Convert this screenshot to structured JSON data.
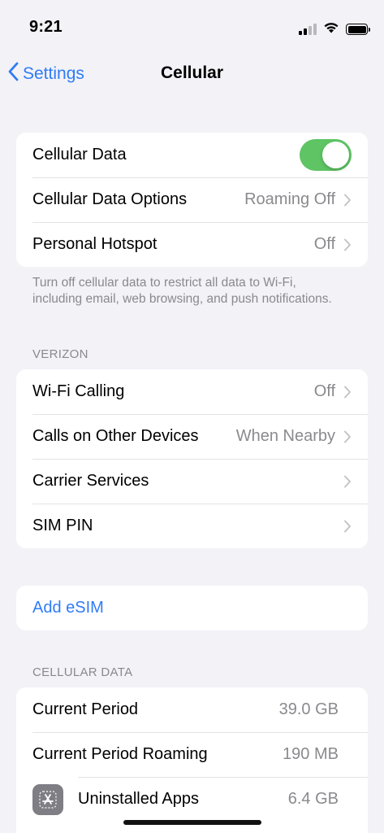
{
  "status_bar": {
    "time": "9:21"
  },
  "nav": {
    "back_label": "Settings",
    "title": "Cellular"
  },
  "group_main": {
    "cellular_data_label": "Cellular Data",
    "cellular_data_on": true,
    "cellular_data_options_label": "Cellular Data Options",
    "cellular_data_options_value": "Roaming Off",
    "personal_hotspot_label": "Personal Hotspot",
    "personal_hotspot_value": "Off"
  },
  "footnote": "Turn off cellular data to restrict all data to Wi-Fi, including email, web browsing, and push notifications.",
  "verizon": {
    "header": "VERIZON",
    "wifi_calling_label": "Wi-Fi Calling",
    "wifi_calling_value": "Off",
    "calls_other_label": "Calls on Other Devices",
    "calls_other_value": "When Nearby",
    "carrier_services_label": "Carrier Services",
    "sim_pin_label": "SIM PIN"
  },
  "esim": {
    "add_label": "Add eSIM"
  },
  "usage": {
    "header": "CELLULAR DATA",
    "current_period_label": "Current Period",
    "current_period_value": "39.0 GB",
    "current_roaming_label": "Current Period Roaming",
    "current_roaming_value": "190 MB",
    "uninstalled_apps_label": "Uninstalled Apps",
    "uninstalled_apps_value": "6.4 GB",
    "uninstalled_apps_icon": "app-store-icon"
  },
  "colors": {
    "accent": "#2f7cf6",
    "toggle_on": "#5ec464",
    "background": "#f2f2f7"
  }
}
